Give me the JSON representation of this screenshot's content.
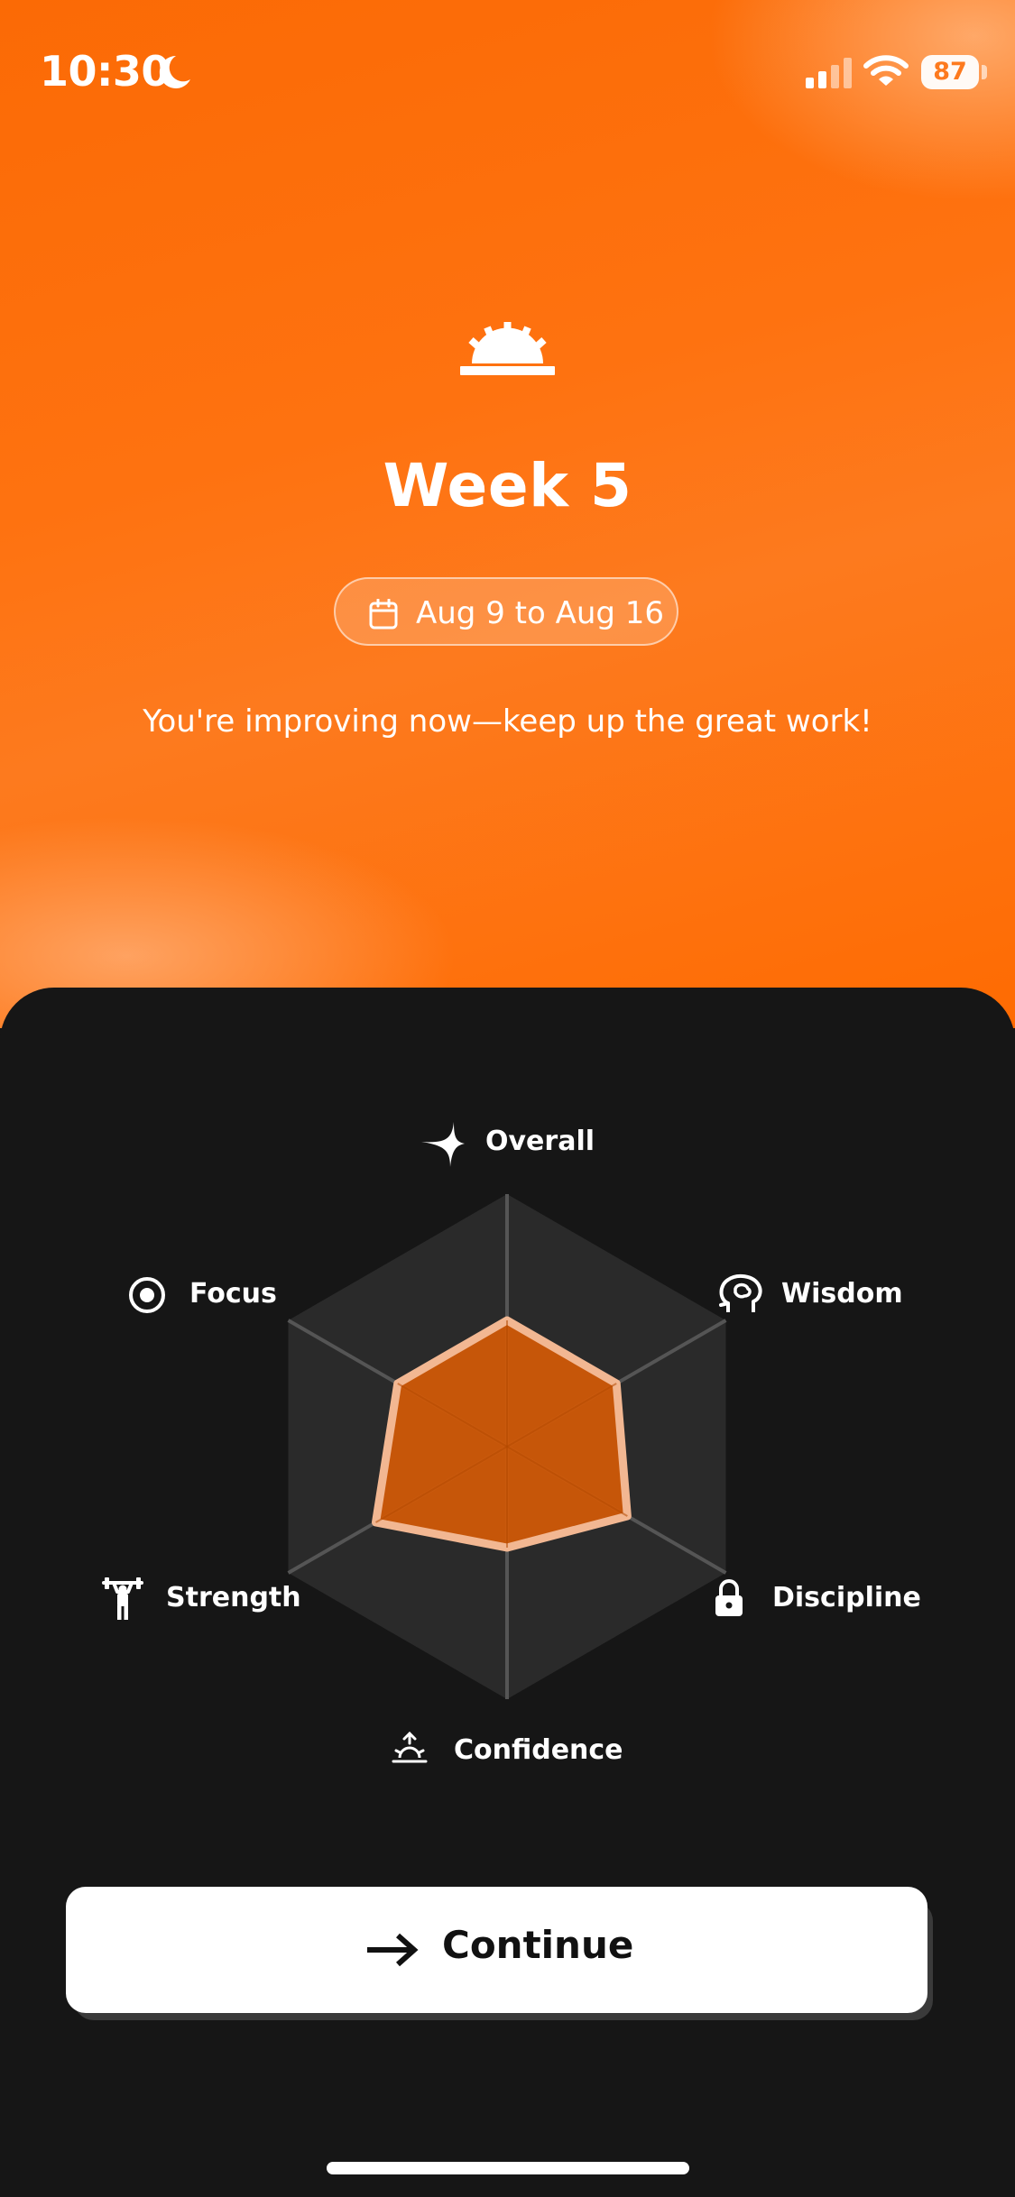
{
  "status_bar": {
    "time": "10:30",
    "battery": "87"
  },
  "header": {
    "logo": "sunrise-logo-icon",
    "title": "Week 5",
    "date_range": "Aug 9 to Aug 16",
    "message": "You're improving now—keep up the great work!"
  },
  "chart_data": {
    "type": "radar",
    "axes": [
      "Overall",
      "Wisdom",
      "Discipline",
      "Confidence",
      "Strength",
      "Focus"
    ],
    "values": [
      0.5,
      0.5,
      0.55,
      0.4,
      0.6,
      0.5
    ],
    "range": [
      0,
      1
    ],
    "fill_color": "#d45a06",
    "outline_color": "#f2b792",
    "grid_color": "#2a2a2a"
  },
  "labels": {
    "overall": "Overall",
    "wisdom": "Wisdom",
    "discipline": "Discipline",
    "confidence": "Confidence",
    "strength": "Strength",
    "focus": "Focus"
  },
  "icons": {
    "overall": "sparkle-icon",
    "wisdom": "brain-head-icon",
    "discipline": "lock-icon",
    "confidence": "sunrise-icon",
    "strength": "weightlifter-icon",
    "focus": "target-icon"
  },
  "continue_button": {
    "label": "Continue"
  },
  "colors": {
    "accent": "#fe6b02",
    "card_background": "#161616",
    "button_background": "#ffffff"
  }
}
